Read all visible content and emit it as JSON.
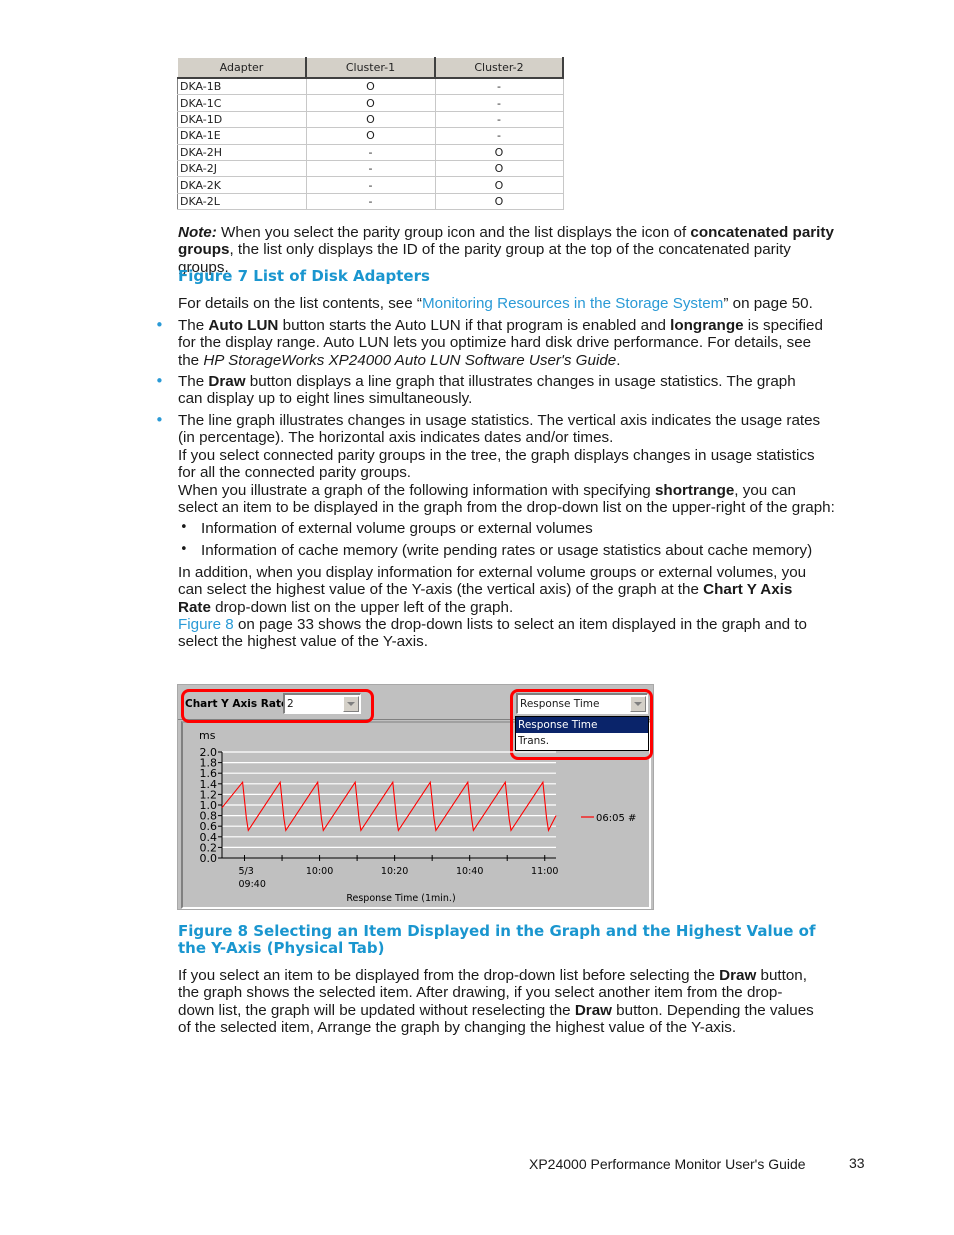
{
  "adapter_table": {
    "headers": [
      "Adapter",
      "Cluster-1",
      "Cluster-2"
    ],
    "rows": [
      [
        "DKA-1B",
        "O",
        "-"
      ],
      [
        "DKA-1C",
        "O",
        "-"
      ],
      [
        "DKA-1D",
        "O",
        "-"
      ],
      [
        "DKA-1E",
        "O",
        "-"
      ],
      [
        "DKA-2H",
        "-",
        "O"
      ],
      [
        "DKA-2J",
        "-",
        "O"
      ],
      [
        "DKA-2K",
        "-",
        "O"
      ],
      [
        "DKA-2L",
        "-",
        "O"
      ]
    ]
  },
  "note": {
    "label": "Note:",
    "text1": " When you select the parity group icon and the list displays the icon of ",
    "bold1": "concatenated parity groups",
    "text2": ", the list only displays the ID of the parity group at the top of the concatenated parity groups."
  },
  "figure7_caption": "Figure 7 List of Disk Adapters",
  "details": {
    "pre": "For details on the list contents, see “",
    "link": "Monitoring Resources in the Storage System",
    "post": "” on page 50."
  },
  "bullets": {
    "b1": {
      "t1": "The ",
      "bold1": "Auto LUN",
      "t2": " button starts the Auto LUN if that program is enabled and ",
      "bold2": "longrange",
      "t3": " is specified for the display range.  Auto LUN lets you optimize hard disk drive performance.  For details, see the ",
      "italic": "HP StorageWorks XP24000 Auto LUN Software User's Guide",
      "t4": "."
    },
    "b2": {
      "t1": "The ",
      "bold1": "Draw",
      "t2": " button displays a line graph that illustrates changes in usage statistics.  The graph can display up to eight lines simultaneously."
    },
    "b3": {
      "p1": "The line graph illustrates changes in usage statistics.  The vertical axis indicates the usage rates (in percentage).  The horizontal axis indicates dates and/or times.",
      "p2": "If you select connected parity groups in the tree, the graph displays changes in usage statistics for all the connected parity groups.",
      "p3a": "When you illustrate a graph of the following information with specifying ",
      "p3bold": "shortrange",
      "p3b": ", you can select an item to be displayed in the graph from the drop-down list on the upper-right of the graph:",
      "sub": [
        "Information of external volume groups or external volumes",
        "Information of cache memory (write pending rates or usage statistics about cache memory)"
      ],
      "p4a": "In addition, when you display information for external volume groups or external volumes, you can select the highest value of the Y-axis (the vertical axis) of the graph at the ",
      "p4bold": "Chart Y Axis Rate",
      "p4b": " drop-down list on the upper left of the graph.",
      "p5link": "Figure 8",
      "p5": " on page 33 shows the drop-down lists to select an item displayed in the graph and to select the highest value of the Y-axis."
    }
  },
  "figure8": {
    "y_axis_rate_label": "Chart Y Axis Rate",
    "y_axis_rate_value": "2",
    "item_select_value": "Response Time",
    "item_options": [
      "Response Time",
      "Trans."
    ],
    "selected_option": "Response Time",
    "highlight_color": "#ff0000"
  },
  "chart_data": {
    "type": "line",
    "title": "",
    "ylabel": "ms",
    "xlabel": "Response Time (1min.)",
    "ylim": [
      0.0,
      2.0
    ],
    "yticks": [
      "0.0",
      "0.2",
      "0.4",
      "0.6",
      "0.8",
      "1.0",
      "1.2",
      "1.4",
      "1.6",
      "1.8",
      "2.0"
    ],
    "xticks": [
      {
        "label": "5/3",
        "label2": "09:40"
      },
      {
        "label": "",
        "label2": ""
      },
      {
        "label": "10:00",
        "label2": ""
      },
      {
        "label": "",
        "label2": ""
      },
      {
        "label": "10:20",
        "label2": ""
      },
      {
        "label": "",
        "label2": ""
      },
      {
        "label": "10:40",
        "label2": ""
      },
      {
        "label": "",
        "label2": ""
      },
      {
        "label": "11:00",
        "label2": ""
      }
    ],
    "grid": true,
    "legend_position": "right",
    "series": [
      {
        "name": "06:05 #",
        "color": "#ff0000",
        "pattern": "sawtooth",
        "x_minutes": [
          0,
          5.5,
          6.5,
          7,
          15.5,
          16.5,
          17,
          25.5,
          26.5,
          27,
          35.5,
          36.5,
          37,
          45.5,
          46.5,
          47,
          55.5,
          56.5,
          57,
          65.5,
          66.5,
          67,
          75.5,
          76.5,
          77,
          85.5,
          86.5,
          87,
          89
        ],
        "values": [
          0.95,
          1.43,
          0.75,
          0.52,
          1.43,
          0.75,
          0.52,
          1.43,
          0.75,
          0.52,
          1.43,
          0.75,
          0.52,
          1.43,
          0.75,
          0.52,
          1.43,
          0.75,
          0.52,
          1.43,
          0.75,
          0.52,
          1.43,
          0.75,
          0.52,
          1.43,
          0.75,
          0.52,
          0.8
        ]
      }
    ]
  },
  "figure8_caption": "Figure 8 Selecting an Item Displayed in the Graph and the Highest Value of the Y-Axis (Physical Tab)",
  "after_fig8": {
    "t1": "If you select an item to be displayed from the drop-down list before selecting the ",
    "bold1": "Draw",
    "t2": " button, the graph shows the selected item.  After drawing, if you select another item from the drop-down list, the graph will be updated without reselecting the ",
    "bold2": "Draw",
    "t3": " button.  Depending the values of the selected item, Arrange the graph by changing the highest value of the Y-axis."
  },
  "footer": {
    "title": "XP24000 Performance Monitor User's Guide",
    "page": "33"
  }
}
